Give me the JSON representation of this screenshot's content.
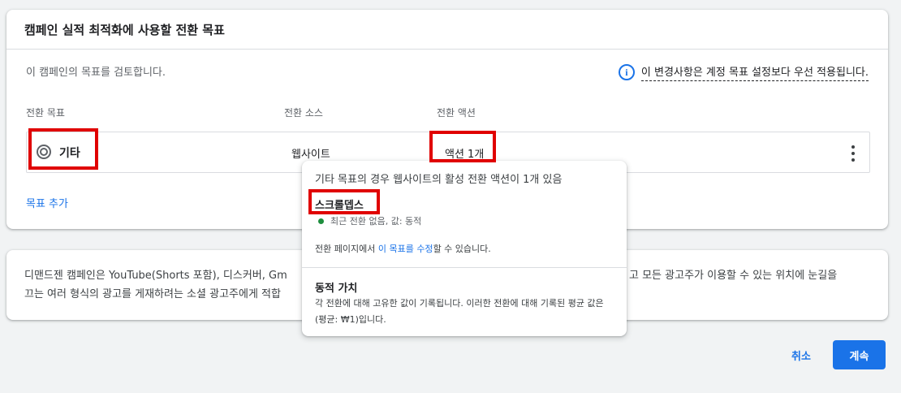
{
  "goals_card": {
    "title": "캠페인 실적 최적화에 사용할 전환 목표",
    "review_text": "이 캠페인의 목표를 검토합니다.",
    "notice_text": "이 변경사항은 계정 목표 설정보다 우선 적용됩니다.",
    "columns": {
      "goal": "전환 목표",
      "source": "전환 소스",
      "action": "전환 액션"
    },
    "row": {
      "icon": "target-icon",
      "goal": "기타",
      "source": "웹사이트",
      "action": "액션 1개"
    },
    "add_goal": "목표 추가"
  },
  "description_card": {
    "line1": "디맨드젠 캠페인은 YouTube(Shorts 포함), 디스커버, Gm",
    "line1_end": "고 모든 광고주가 이용할 수 있는 위치에 눈길을",
    "line2": "끄는 여러 형식의 광고를 게재하려는 소셜 광고주에게 적합"
  },
  "tooltip": {
    "heading": "기타 목표의 경우 웹사이트의 활성 전환 액션이 1개 있음",
    "action_name": "스크롤뎁스",
    "status": "최근 전환 없음, 값: 동적",
    "edit_prefix": "전환 페이지에서 ",
    "edit_link": "이 목표를 수정",
    "edit_suffix": "할 수 있습니다.",
    "dynamic_title": "동적 가치",
    "dynamic_desc": "각 전환에 대해 고유한 값이 기록됩니다. 이러한 전환에 대해 기록된 평균 값은 (평균: ₩1)입니다."
  },
  "footer": {
    "cancel": "취소",
    "continue": "계속"
  },
  "colors": {
    "accent": "#1a73e8",
    "status_green": "#1e8e3e",
    "highlight_red": "#e00000"
  }
}
